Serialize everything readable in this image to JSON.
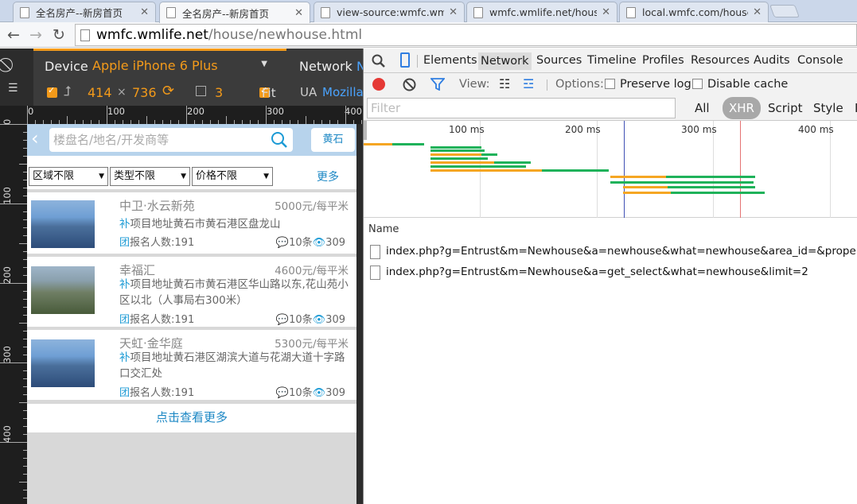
{
  "browser": {
    "tabs": [
      {
        "title": "全名房产--新房首页"
      },
      {
        "title": "全名房产--新房首页"
      },
      {
        "title": "view-source:wmfc.wmlif"
      },
      {
        "title": "wmfc.wmlife.net/house/"
      },
      {
        "title": "local.wmfc.com/house/j"
      }
    ],
    "address": {
      "host": "wmfc.wmlife.net",
      "path": "/house/newhouse.html"
    }
  },
  "emulation": {
    "device_label": "Device",
    "device_value": "Apple iPhone 6 Plus",
    "width": "414",
    "times": "×",
    "height": "736",
    "dpr": "3",
    "fit_label": "Fit",
    "network_label": "Network",
    "network_value_partial": "N",
    "ua_label": "UA",
    "ua_value": "Mozilla/"
  },
  "ruler": {
    "top_labels": [
      "0",
      "100",
      "200",
      "300",
      "400"
    ],
    "left_labels": [
      "0",
      "100",
      "200",
      "300",
      "400"
    ]
  },
  "phone": {
    "search_placeholder": "楼盘名/地名/开发商等",
    "city_button": "黄石",
    "filters": [
      "区域不限",
      "类型不限",
      "价格不限"
    ],
    "filter_more": "更多",
    "listings": [
      {
        "name": "中卫·水云新苑",
        "price": "5000元/每平米",
        "addr_tag": "补",
        "address": "项目地址黄石市黄石港区盘龙山",
        "meta_tag": "团",
        "signups": "报名人数:191",
        "comments": "10条",
        "views": "309"
      },
      {
        "name": "幸福汇",
        "price": "4600元/每平米",
        "addr_tag": "补",
        "address": "项目地址黄石市黄石港区华山路以东,花山苑小区以北（人事局右300米）",
        "meta_tag": "团",
        "signups": "报名人数:191",
        "comments": "10条",
        "views": "309"
      },
      {
        "name": "天虹·金华庭",
        "price": "5300元/每平米",
        "addr_tag": "补",
        "address": "项目地址黄石港区湖滨大道与花湖大道十字路口交汇处",
        "meta_tag": "团",
        "signups": "报名人数:191",
        "comments": "10条",
        "views": "309"
      }
    ],
    "more_button": "点击查看更多"
  },
  "devtools": {
    "panels": [
      "Elements",
      "Network",
      "Sources",
      "Timeline",
      "Profiles",
      "Resources",
      "Audits",
      "Console"
    ],
    "active_panel": "Network",
    "view_label": "View:",
    "options_label": "Options:",
    "preserve_log": "Preserve log",
    "disable_cache": "Disable cache",
    "filter_placeholder": "Filter",
    "filter_types": [
      "All",
      "XHR",
      "Script",
      "Style",
      "I"
    ],
    "active_filter": "XHR",
    "timeline_labels": [
      "100 ms",
      "200 ms",
      "300 ms",
      "400 ms"
    ],
    "name_header": "Name",
    "requests": [
      "index.php?g=Entrust&m=Newhouse&a=newhouse&what=newhouse&area_id=&property_type=",
      "index.php?g=Entrust&m=Newhouse&a=get_select&what=newhouse&limit=2"
    ]
  },
  "colors": {
    "accent_orange": "#f39a1a",
    "link_blue": "#1b87c4",
    "record_red": "#e53935",
    "bar_green": "#1fb25a",
    "bar_orange": "#f5a623"
  }
}
